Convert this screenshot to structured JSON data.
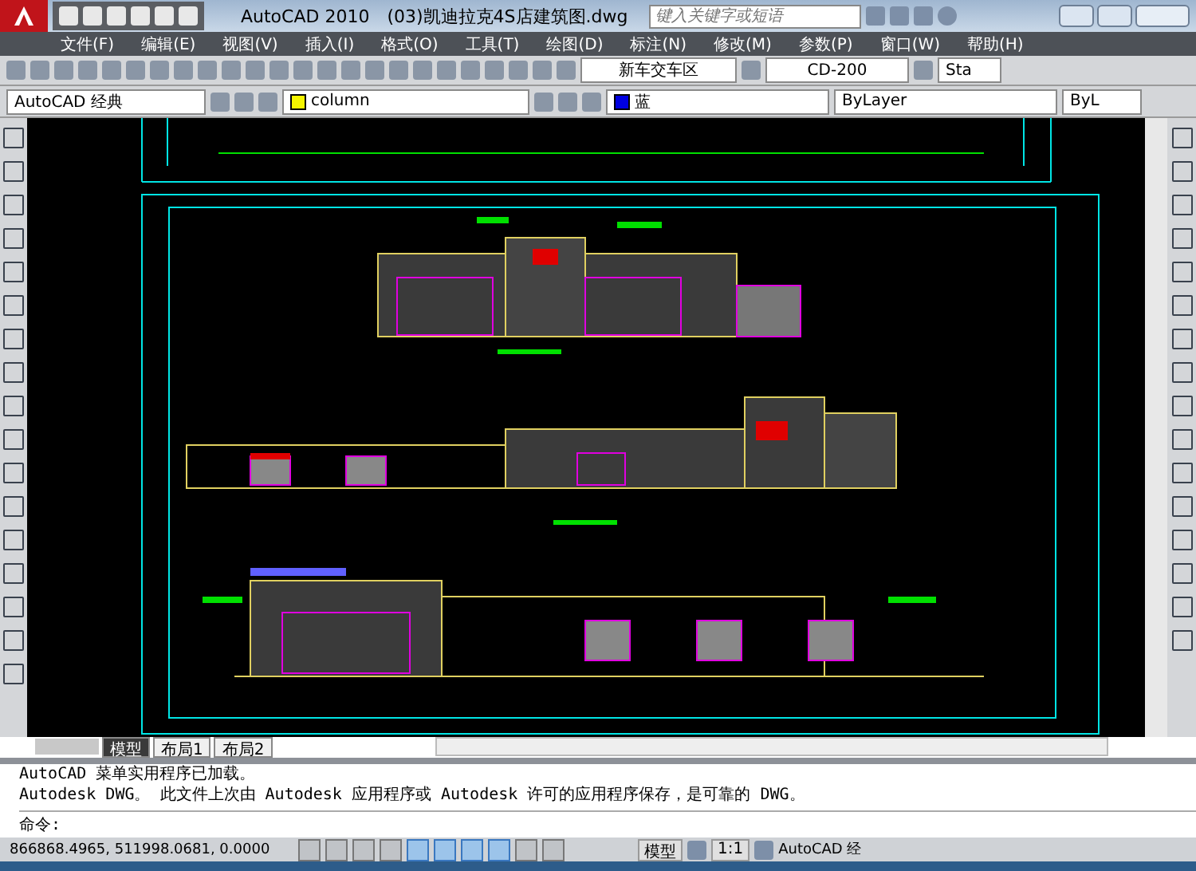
{
  "title_bar": {
    "app": "AutoCAD 2010",
    "file": "(03)凯迪拉克4S店建筑图.dwg",
    "search": {
      "placeholder": "键入关键字或短语"
    }
  },
  "menu": [
    "文件(F)",
    "编辑(E)",
    "视图(V)",
    "插入(I)",
    "格式(O)",
    "工具(T)",
    "绘图(D)",
    "标注(N)",
    "修改(M)",
    "参数(P)",
    "窗口(W)",
    "帮助(H)"
  ],
  "toolbar": {
    "text_style": "新车交车区",
    "dim_style": "CD-200",
    "table_style": "Sta"
  },
  "properties_bar": {
    "workspace": "AutoCAD 经典",
    "layer": "column",
    "color_name": "蓝",
    "linetype": "ByLayer",
    "lineweight": "ByL"
  },
  "layout_tabs": [
    {
      "label": "模型",
      "selected": true
    },
    {
      "label": "布局1",
      "selected": false
    },
    {
      "label": "布局2",
      "selected": false
    }
  ],
  "command_history": [
    "AutoCAD 菜单实用程序已加载。",
    "Autodesk DWG。  此文件上次由 Autodesk 应用程序或 Autodesk 许可的应用程序保存，是可靠的 DWG。"
  ],
  "command_prompt": "命令:",
  "status_bar": {
    "coordinates": "866868.4965, 511998.0681, 0.0000",
    "toggles": [
      {
        "on": false
      },
      {
        "on": false
      },
      {
        "on": false
      },
      {
        "on": false
      },
      {
        "on": true
      },
      {
        "on": true
      },
      {
        "on": true
      },
      {
        "on": true
      },
      {
        "on": false
      },
      {
        "on": false
      }
    ],
    "model_label": "模型",
    "scale": "1:1",
    "workspace": "AutoCAD 经"
  }
}
